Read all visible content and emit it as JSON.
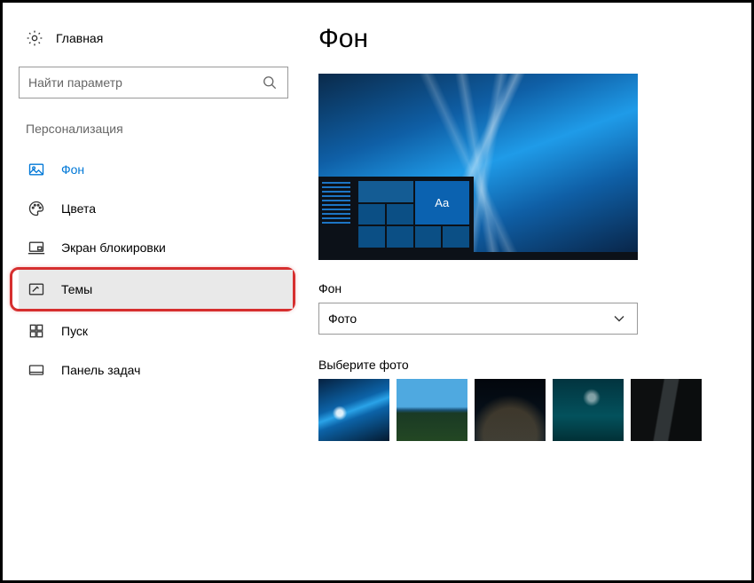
{
  "home_label": "Главная",
  "search_placeholder": "Найти параметр",
  "section_title": "Персонализация",
  "nav": [
    {
      "key": "background",
      "label": "Фон",
      "active": true
    },
    {
      "key": "colors",
      "label": "Цвета",
      "active": false
    },
    {
      "key": "lockscreen",
      "label": "Экран блокировки",
      "active": false
    },
    {
      "key": "themes",
      "label": "Темы",
      "active": false,
      "hover": true,
      "highlight": true
    },
    {
      "key": "start",
      "label": "Пуск",
      "active": false
    },
    {
      "key": "taskbar",
      "label": "Панель задач",
      "active": false
    }
  ],
  "page_title": "Фон",
  "preview_tile_text": "Aa",
  "bg_field_label": "Фон",
  "bg_dropdown_value": "Фото",
  "choose_photo_label": "Выберите фото",
  "colors": {
    "accent": "#0078d7",
    "highlight_border": "#d62f2f"
  }
}
